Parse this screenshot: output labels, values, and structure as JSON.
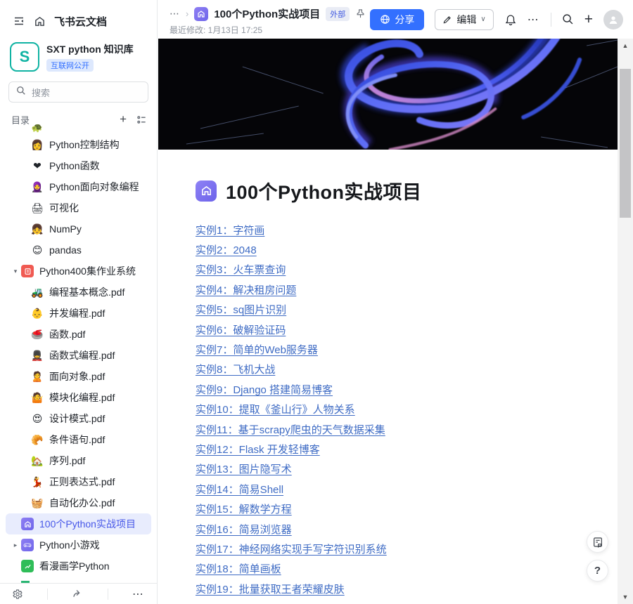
{
  "colors": {
    "accent": "#3370ff",
    "link": "#3e6bc4",
    "selected_bg": "#e8ecfd",
    "selected_text": "#4757e8",
    "badge_bg": "#dde8fd",
    "space_teal": "#10b3a3"
  },
  "sidebar": {
    "app_title": "飞书云文档",
    "space": {
      "initial": "S",
      "name": "SXT python 知识库",
      "badge": "互联网公开"
    },
    "search": {
      "placeholder": "搜索"
    },
    "directory_label": "目录",
    "tree": [
      {
        "icon": "🐢",
        "icon_name": "turtle-icon",
        "label": "",
        "level": 2,
        "partial": true
      },
      {
        "icon": "👩",
        "icon_name": "woman-icon",
        "label": "Python控制结构",
        "level": 2
      },
      {
        "icon": "❤",
        "icon_name": "heart-icon",
        "label": "Python函数",
        "level": 2
      },
      {
        "icon": "🧕",
        "icon_name": "woman-headscarf-icon",
        "label": "Python面向对象编程",
        "level": 2
      },
      {
        "icon": "🖨",
        "icon_name": "printer-icon",
        "label": "可视化",
        "level": 2
      },
      {
        "icon": "👧",
        "icon_name": "girl-icon",
        "label": "NumPy",
        "level": 2
      },
      {
        "icon": "😊",
        "icon_name": "smiley-icon",
        "label": "pandas",
        "level": 2
      },
      {
        "icon_type": "red-space",
        "icon_name": "red-space-icon",
        "label": "Python400集作业系统",
        "level": 1,
        "expander": "down"
      },
      {
        "icon": "🚜",
        "icon_name": "tractor-icon",
        "label": "编程基本概念.pdf",
        "level": 2
      },
      {
        "icon": "👶",
        "icon_name": "baby-icon",
        "label": "并发编程.pdf",
        "level": 2
      },
      {
        "icon": "🥌",
        "icon_name": "curling-stone-icon",
        "label": "函数.pdf",
        "level": 2
      },
      {
        "icon": "💂",
        "icon_name": "guard-icon",
        "label": "函数式编程.pdf",
        "level": 2
      },
      {
        "icon": "🙎",
        "icon_name": "person-icon",
        "label": "面向对象.pdf",
        "level": 2
      },
      {
        "icon": "🤷",
        "icon_name": "shrug-icon",
        "label": "模块化编程.pdf",
        "level": 2
      },
      {
        "icon": "😍",
        "icon_name": "heart-eyes-icon",
        "label": "设计模式.pdf",
        "level": 2
      },
      {
        "icon": "🥐",
        "icon_name": "croissant-icon",
        "label": "条件语句.pdf",
        "level": 2
      },
      {
        "icon": "🏡",
        "icon_name": "green-house-icon",
        "label": "序列.pdf",
        "level": 2
      },
      {
        "icon": "💃",
        "icon_name": "dancer-icon",
        "label": "正则表达式.pdf",
        "level": 2
      },
      {
        "icon": "🧺",
        "icon_name": "basket-icon",
        "label": "自动化办公.pdf",
        "level": 2
      },
      {
        "icon_type": "purple-home",
        "icon_name": "home-icon",
        "label": "100个Python实战项目",
        "level": 1,
        "selected": true
      },
      {
        "icon_type": "purple-game",
        "icon_name": "gamepad-icon",
        "label": "Python小游戏",
        "level": 1,
        "expander": "right"
      },
      {
        "icon_type": "green-chart",
        "icon_name": "chart-icon",
        "label": "看漫画学Python",
        "level": 1
      }
    ]
  },
  "header": {
    "breadcrumb_more": "⋯",
    "breadcrumb_chevron": "›",
    "doc_title": "100个Python实战项目",
    "external_badge": "外部",
    "last_modified": "最近修改: 1月13日 17:25",
    "share_label": "分享",
    "edit_label": "编辑"
  },
  "document": {
    "title": "100个Python实战项目",
    "links": [
      "实例1：字符画",
      "实例2：2048",
      "实例3：火车票查询",
      "实例4：解决租房问题",
      "实例5：sq图片识别",
      "实例6：破解验证码",
      "实例7：简单的Web服务器",
      "实例8：飞机大战",
      "实例9：Django 搭建简易博客",
      "实例10：提取《釜山行》人物关系",
      "实例11：基于scrapy爬虫的天气数据采集",
      "实例12：Flask 开发轻博客",
      "实例13：图片隐写术",
      "实例14：简易Shell",
      "实例15：解数学方程",
      "实例16：简易浏览器",
      "实例17：神经网络实现手写字符识别系统",
      "实例18：简单画板",
      "实例19：批量获取王者荣耀皮肤"
    ]
  },
  "floating": {
    "help_label": "?"
  }
}
